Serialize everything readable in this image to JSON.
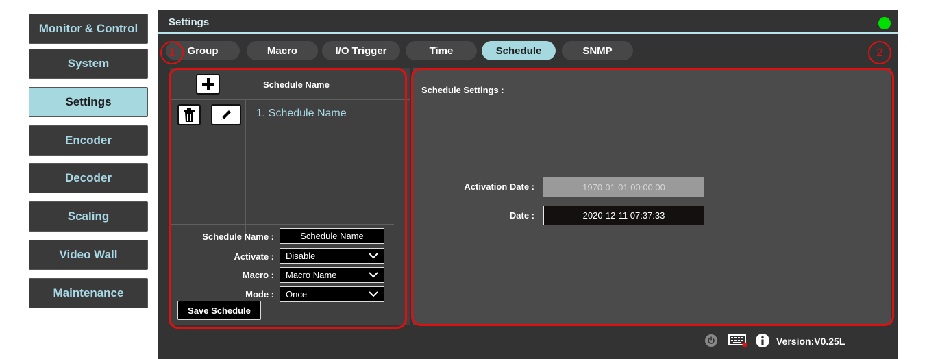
{
  "sidebar": {
    "items": [
      {
        "label": "Monitor & Control"
      },
      {
        "label": "System"
      },
      {
        "label": "Settings",
        "active": true
      },
      {
        "label": "Encoder"
      },
      {
        "label": "Decoder"
      },
      {
        "label": "Scaling"
      },
      {
        "label": "Video Wall"
      },
      {
        "label": "Maintenance"
      }
    ]
  },
  "panel": {
    "title": "Settings",
    "status_color": "#00e000"
  },
  "tabs": [
    {
      "label": "Group"
    },
    {
      "label": "Macro"
    },
    {
      "label": "I/O Trigger"
    },
    {
      "label": "Time"
    },
    {
      "label": "Schedule",
      "active": true
    },
    {
      "label": "SNMP"
    }
  ],
  "markers": {
    "one": "1",
    "two": "2"
  },
  "schedule_list": {
    "column_header": "Schedule Name",
    "items": [
      "1. Schedule Name"
    ]
  },
  "form": {
    "name_label": "Schedule Name :",
    "name_value": "Schedule Name",
    "activate_label": "Activate :",
    "activate_value": "Disable",
    "macro_label": "Macro :",
    "macro_value": "Macro Name",
    "mode_label": "Mode :",
    "mode_value": "Once",
    "save_label": "Save Schedule"
  },
  "settings": {
    "title": "Schedule Settings :",
    "activation_label": "Activation Date :",
    "activation_value": "1970-01-01 00:00:00",
    "date_label": "Date :",
    "date_value": "2020-12-11 07:37:33"
  },
  "footer": {
    "version": "Version:V0.25L"
  },
  "colors": {
    "accent": "#a6d8e0",
    "highlight": "#e01010"
  }
}
